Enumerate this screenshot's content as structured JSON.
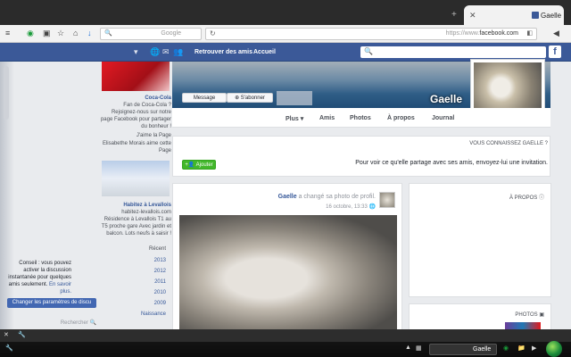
{
  "browser": {
    "tab_title": "Gaelle",
    "url": "https://www.facebook.com",
    "url_prefix": "https://www.",
    "url_domain": "facebook.com",
    "search_placeholder": "Google"
  },
  "fb_nav": {
    "home": "Accueil",
    "find_friends": "Retrouver des amis"
  },
  "profile": {
    "name": "Gaelle",
    "message_button": "Message",
    "follow_button": "S'abonner",
    "tabs": [
      "Journal",
      "À propos",
      "Amis",
      "Photos",
      "Plus ▾"
    ]
  },
  "know_box": {
    "title": "VOUS CONNAISSEZ GAELLE ?",
    "text": "Pour voir ce qu'elle partage avec ses amis, envoyez-lui une invitation.",
    "add_button": "Ajouter"
  },
  "about": {
    "title": "À PROPOS"
  },
  "photos": {
    "title": "PHOTOS"
  },
  "post": {
    "author": "Gaelle",
    "action": "a changé sa photo de profil.",
    "date": "16 octobre, 13:33"
  },
  "ads": [
    {
      "title": "Coca-Cola",
      "text": "Fan de Coca-Cola ? Rejoignez-nous sur notre page Facebook pour partager du bonheur !",
      "like": "J'aime la Page",
      "social": "Elisabethe Morais aime cette Page"
    },
    {
      "title": "Habitez à Levallois",
      "domain": "habitez-levallois.com",
      "text": "Résidence à Levallois T1 au T5 proche gare Avec jardin et balcon. Lots neufs à saisir !"
    }
  ],
  "years": [
    "Récent",
    "2013",
    "2012",
    "2011",
    "2010",
    "2009",
    "Naissance"
  ],
  "notice": {
    "text": "Conseil : vous pouvez activer la discussion instantanée pour quelques amis seulement.",
    "link": "En savoir plus.",
    "button": "Changer les paramètres de discu",
    "search": "Rechercher"
  },
  "taskbar": {
    "app": "Gaelle"
  }
}
